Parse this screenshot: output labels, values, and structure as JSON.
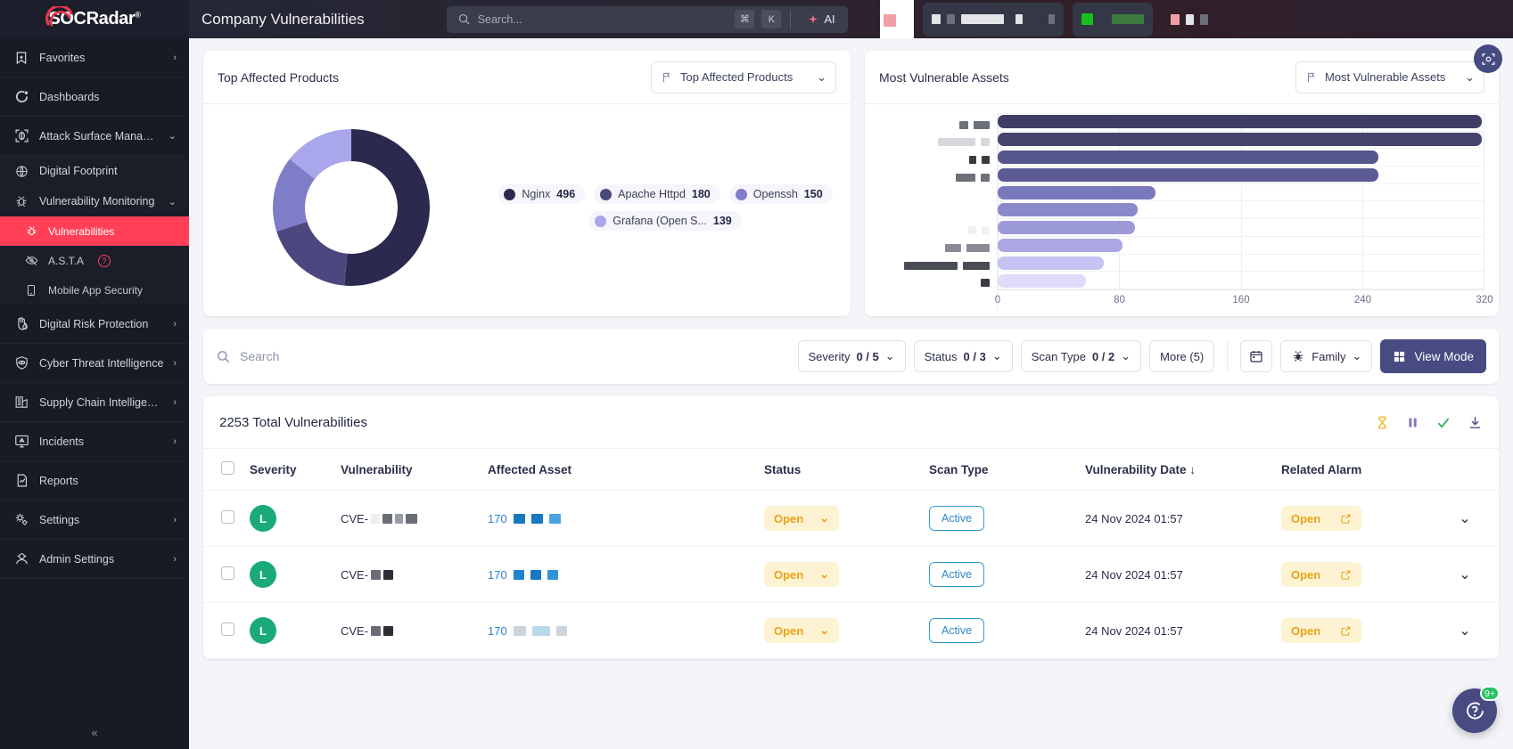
{
  "brand": {
    "name": "SOCRadar",
    "registered": "®"
  },
  "sidebar": {
    "items": [
      {
        "label": "Favorites",
        "icon": "bookmark-star-icon",
        "chevron": "›"
      },
      {
        "label": "Dashboards",
        "icon": "dashboard-icon",
        "chevron": ""
      },
      {
        "label": "Attack Surface Management",
        "icon": "shield-scan-icon",
        "chevron": "⌄"
      },
      {
        "label": "Digital Footprint",
        "icon": "globe-icon",
        "chevron": ""
      },
      {
        "label": "Vulnerability Monitoring",
        "icon": "bug-scan-icon",
        "chevron": "⌄"
      },
      {
        "label": "Vulnerabilities",
        "icon": "bug-icon",
        "chevron": ""
      },
      {
        "label": "A.S.T.A",
        "icon": "radar-eye-icon",
        "chevron": "",
        "badge": "?"
      },
      {
        "label": "Mobile App Security",
        "icon": "mobile-icon",
        "chevron": ""
      },
      {
        "label": "Digital Risk Protection",
        "icon": "hand-shield-icon",
        "chevron": "›"
      },
      {
        "label": "Cyber Threat Intelligence",
        "icon": "shield-eye-icon",
        "chevron": "›"
      },
      {
        "label": "Supply Chain Intelligence",
        "icon": "factory-icon",
        "chevron": "›"
      },
      {
        "label": "Incidents",
        "icon": "monitor-alert-icon",
        "chevron": "›"
      },
      {
        "label": "Reports",
        "icon": "report-chart-icon",
        "chevron": ""
      },
      {
        "label": "Settings",
        "icon": "gears-icon",
        "chevron": "›"
      },
      {
        "label": "Admin Settings",
        "icon": "admin-user-icon",
        "chevron": "›"
      }
    ],
    "collapse": "«",
    "active_label": "Vulnerabilities",
    "accent": "#ff4057"
  },
  "topbar": {
    "page_title": "Company Vulnerabilities",
    "search_placeholder": "Search...",
    "kbd_cmd": "⌘",
    "kbd_key": "K",
    "ai_label": "AI"
  },
  "cards": {
    "top_affected": {
      "title": "Top Affected Products",
      "select_label": "Top Affected Products",
      "select_icon": "flag-icon",
      "chevron": "⌄"
    },
    "most_vulnerable": {
      "title": "Most Vulnerable Assets",
      "select_label": "Most Vulnerable Assets",
      "select_icon": "flag-icon",
      "chevron": "⌄"
    }
  },
  "chart_data": [
    {
      "type": "pie",
      "title": "Top Affected Products",
      "labels": [
        "Nginx",
        "Apache Httpd",
        "Openssh",
        "Grafana (Open S..."
      ],
      "values": [
        496,
        180,
        150,
        139
      ],
      "colors": [
        "#2b2a4e",
        "#4a487e",
        "#7f7cc8",
        "#a9a6ec"
      ],
      "donut": true,
      "legend": "right"
    },
    {
      "type": "bar",
      "orientation": "horizontal",
      "title": "Most Vulnerable Assets",
      "categories": [
        "asset-1",
        "asset-2",
        "asset-3",
        "asset-4",
        "asset-5",
        "asset-6",
        "asset-7",
        "asset-8",
        "asset-9",
        "asset-10"
      ],
      "category_labels_redacted": true,
      "values": [
        318,
        318,
        250,
        250,
        104,
        92,
        90,
        82,
        70,
        58
      ],
      "colors": [
        "#3f3d63",
        "#45446e",
        "#56558c",
        "#5b5a95",
        "#7a78bd",
        "#8b89cc",
        "#9d9ada",
        "#aaa7e4",
        "#c5c3f2",
        "#dedcfa"
      ],
      "xlabel": "",
      "ylabel": "",
      "xlim": [
        0,
        320
      ],
      "xticks": [
        0,
        80,
        160,
        240,
        320
      ],
      "grid": true
    }
  ],
  "toolbar": {
    "search_placeholder": "Search",
    "search_icon": "search-icon",
    "filters": [
      {
        "label": "Severity",
        "count": "0 / 5",
        "chevron": "⌄"
      },
      {
        "label": "Status",
        "count": "0 / 3",
        "chevron": "⌄"
      },
      {
        "label": "Scan Type",
        "count": "0 / 2",
        "chevron": "⌄"
      }
    ],
    "more_label": "More (5)",
    "calendar_icon": "calendar-icon",
    "family_label": "Family",
    "family_icon": "bug-icon",
    "family_chevron": "⌄",
    "view_mode_label": "View Mode",
    "view_mode_icon": "grid-icon"
  },
  "table": {
    "total_label": "2253 Total Vulnerabilities",
    "actions": [
      {
        "name": "hourglass-icon",
        "glyph": "⧗",
        "color": "#f0b323"
      },
      {
        "name": "pause-icon",
        "glyph": "❚❚",
        "color": "#7a78bd"
      },
      {
        "name": "check-icon",
        "glyph": "✓",
        "color": "#2fb65e"
      },
      {
        "name": "download-icon",
        "glyph": "⤓",
        "color": "#474b81"
      }
    ],
    "columns": [
      {
        "label": "",
        "name": "select-all"
      },
      {
        "label": "Severity"
      },
      {
        "label": "Vulnerability"
      },
      {
        "label": "Affected Asset"
      },
      {
        "label": "Status"
      },
      {
        "label": "Scan Type"
      },
      {
        "label": "Vulnerability Date",
        "sort": "↓"
      },
      {
        "label": "Related Alarm"
      },
      {
        "label": ""
      }
    ],
    "rows": [
      {
        "severity": "L",
        "severity_color": "#1aa97b",
        "cve_prefix": "CVE-",
        "cve_redacted": true,
        "asset_prefix": "170",
        "status": "Open",
        "scan_type": "Active",
        "date": "24 Nov 2024 01:57",
        "alarm": "Open",
        "expand": "⌄"
      },
      {
        "severity": "L",
        "severity_color": "#1aa97b",
        "cve_prefix": "CVE-",
        "cve_redacted": true,
        "asset_prefix": "170",
        "status": "Open",
        "scan_type": "Active",
        "date": "24 Nov 2024 01:57",
        "alarm": "Open",
        "expand": "⌄"
      },
      {
        "severity": "L",
        "severity_color": "#1aa97b",
        "cve_prefix": "CVE-",
        "cve_redacted": true,
        "asset_prefix": "170",
        "status": "Open",
        "scan_type": "Active",
        "date": "24 Nov 2024 01:57",
        "alarm": "Open",
        "expand": "⌄"
      }
    ]
  },
  "floating": {
    "scan_icon": "focus-scan-icon",
    "chat_icon": "chat-help-icon",
    "chat_count": "9+"
  }
}
